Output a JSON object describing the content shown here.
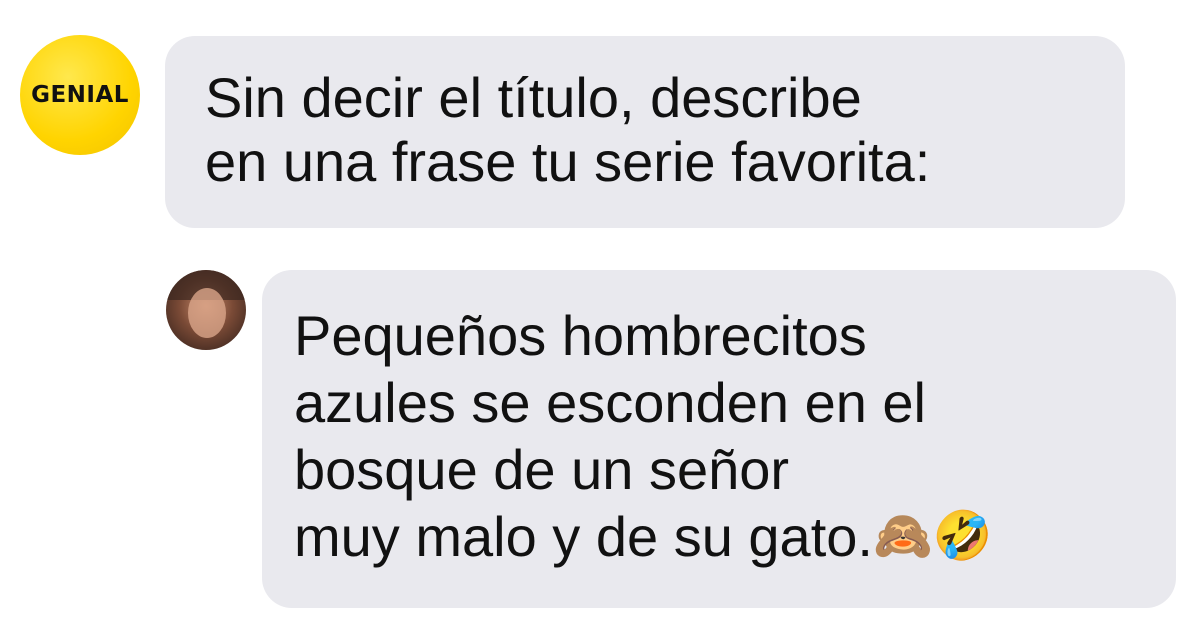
{
  "sender": {
    "avatar_text": "GENIAL"
  },
  "question": {
    "lines": [
      "Sin decir el título, describe",
      "en una frase tu serie favorita:"
    ]
  },
  "answer": {
    "lines": [
      "Pequeños hombrecitos",
      "azules se esconden en el",
      "bosque de un señor",
      "muy malo y de su gato."
    ],
    "emojis": [
      "🙈",
      "🤣"
    ]
  },
  "colors": {
    "bubble": "#e9e9ee",
    "brand_yellow": "#ffd400"
  }
}
